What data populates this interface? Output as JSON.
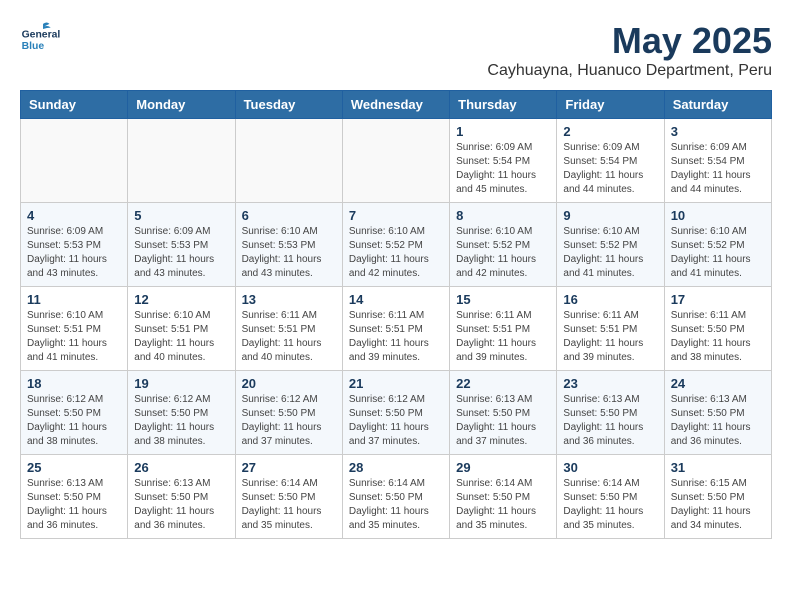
{
  "header": {
    "logo_general": "General",
    "logo_blue": "Blue",
    "title": "May 2025",
    "subtitle": "Cayhuayna, Huanuco Department, Peru"
  },
  "weekdays": [
    "Sunday",
    "Monday",
    "Tuesday",
    "Wednesday",
    "Thursday",
    "Friday",
    "Saturday"
  ],
  "weeks": [
    [
      {
        "day": "",
        "info": ""
      },
      {
        "day": "",
        "info": ""
      },
      {
        "day": "",
        "info": ""
      },
      {
        "day": "",
        "info": ""
      },
      {
        "day": "1",
        "info": "Sunrise: 6:09 AM\nSunset: 5:54 PM\nDaylight: 11 hours\nand 45 minutes."
      },
      {
        "day": "2",
        "info": "Sunrise: 6:09 AM\nSunset: 5:54 PM\nDaylight: 11 hours\nand 44 minutes."
      },
      {
        "day": "3",
        "info": "Sunrise: 6:09 AM\nSunset: 5:54 PM\nDaylight: 11 hours\nand 44 minutes."
      }
    ],
    [
      {
        "day": "4",
        "info": "Sunrise: 6:09 AM\nSunset: 5:53 PM\nDaylight: 11 hours\nand 43 minutes."
      },
      {
        "day": "5",
        "info": "Sunrise: 6:09 AM\nSunset: 5:53 PM\nDaylight: 11 hours\nand 43 minutes."
      },
      {
        "day": "6",
        "info": "Sunrise: 6:10 AM\nSunset: 5:53 PM\nDaylight: 11 hours\nand 43 minutes."
      },
      {
        "day": "7",
        "info": "Sunrise: 6:10 AM\nSunset: 5:52 PM\nDaylight: 11 hours\nand 42 minutes."
      },
      {
        "day": "8",
        "info": "Sunrise: 6:10 AM\nSunset: 5:52 PM\nDaylight: 11 hours\nand 42 minutes."
      },
      {
        "day": "9",
        "info": "Sunrise: 6:10 AM\nSunset: 5:52 PM\nDaylight: 11 hours\nand 41 minutes."
      },
      {
        "day": "10",
        "info": "Sunrise: 6:10 AM\nSunset: 5:52 PM\nDaylight: 11 hours\nand 41 minutes."
      }
    ],
    [
      {
        "day": "11",
        "info": "Sunrise: 6:10 AM\nSunset: 5:51 PM\nDaylight: 11 hours\nand 41 minutes."
      },
      {
        "day": "12",
        "info": "Sunrise: 6:10 AM\nSunset: 5:51 PM\nDaylight: 11 hours\nand 40 minutes."
      },
      {
        "day": "13",
        "info": "Sunrise: 6:11 AM\nSunset: 5:51 PM\nDaylight: 11 hours\nand 40 minutes."
      },
      {
        "day": "14",
        "info": "Sunrise: 6:11 AM\nSunset: 5:51 PM\nDaylight: 11 hours\nand 39 minutes."
      },
      {
        "day": "15",
        "info": "Sunrise: 6:11 AM\nSunset: 5:51 PM\nDaylight: 11 hours\nand 39 minutes."
      },
      {
        "day": "16",
        "info": "Sunrise: 6:11 AM\nSunset: 5:51 PM\nDaylight: 11 hours\nand 39 minutes."
      },
      {
        "day": "17",
        "info": "Sunrise: 6:11 AM\nSunset: 5:50 PM\nDaylight: 11 hours\nand 38 minutes."
      }
    ],
    [
      {
        "day": "18",
        "info": "Sunrise: 6:12 AM\nSunset: 5:50 PM\nDaylight: 11 hours\nand 38 minutes."
      },
      {
        "day": "19",
        "info": "Sunrise: 6:12 AM\nSunset: 5:50 PM\nDaylight: 11 hours\nand 38 minutes."
      },
      {
        "day": "20",
        "info": "Sunrise: 6:12 AM\nSunset: 5:50 PM\nDaylight: 11 hours\nand 37 minutes."
      },
      {
        "day": "21",
        "info": "Sunrise: 6:12 AM\nSunset: 5:50 PM\nDaylight: 11 hours\nand 37 minutes."
      },
      {
        "day": "22",
        "info": "Sunrise: 6:13 AM\nSunset: 5:50 PM\nDaylight: 11 hours\nand 37 minutes."
      },
      {
        "day": "23",
        "info": "Sunrise: 6:13 AM\nSunset: 5:50 PM\nDaylight: 11 hours\nand 36 minutes."
      },
      {
        "day": "24",
        "info": "Sunrise: 6:13 AM\nSunset: 5:50 PM\nDaylight: 11 hours\nand 36 minutes."
      }
    ],
    [
      {
        "day": "25",
        "info": "Sunrise: 6:13 AM\nSunset: 5:50 PM\nDaylight: 11 hours\nand 36 minutes."
      },
      {
        "day": "26",
        "info": "Sunrise: 6:13 AM\nSunset: 5:50 PM\nDaylight: 11 hours\nand 36 minutes."
      },
      {
        "day": "27",
        "info": "Sunrise: 6:14 AM\nSunset: 5:50 PM\nDaylight: 11 hours\nand 35 minutes."
      },
      {
        "day": "28",
        "info": "Sunrise: 6:14 AM\nSunset: 5:50 PM\nDaylight: 11 hours\nand 35 minutes."
      },
      {
        "day": "29",
        "info": "Sunrise: 6:14 AM\nSunset: 5:50 PM\nDaylight: 11 hours\nand 35 minutes."
      },
      {
        "day": "30",
        "info": "Sunrise: 6:14 AM\nSunset: 5:50 PM\nDaylight: 11 hours\nand 35 minutes."
      },
      {
        "day": "31",
        "info": "Sunrise: 6:15 AM\nSunset: 5:50 PM\nDaylight: 11 hours\nand 34 minutes."
      }
    ]
  ]
}
